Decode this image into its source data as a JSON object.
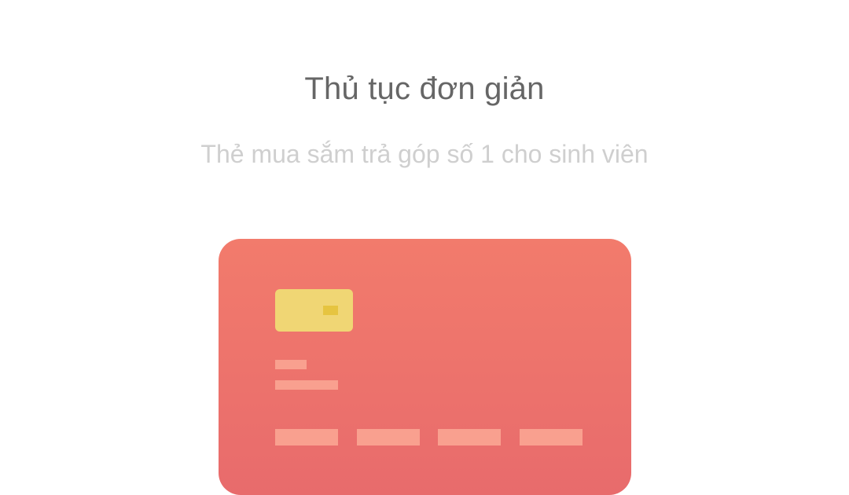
{
  "onboarding": {
    "title": "Thủ tục đơn giản",
    "subtitle": "Thẻ mua sắm trả góp số 1 cho sinh viên"
  },
  "card_illustration": {
    "icon": "credit-card-icon",
    "gradient_top": "#f27b6c",
    "gradient_bottom": "#e86b6c",
    "chip_color": "#f0d674",
    "chip_contact_color": "#e6c440",
    "bar_color": "#f9a08f"
  },
  "colors": {
    "title": "#666666",
    "subtitle": "#cfcfcf",
    "background": "#ffffff"
  }
}
